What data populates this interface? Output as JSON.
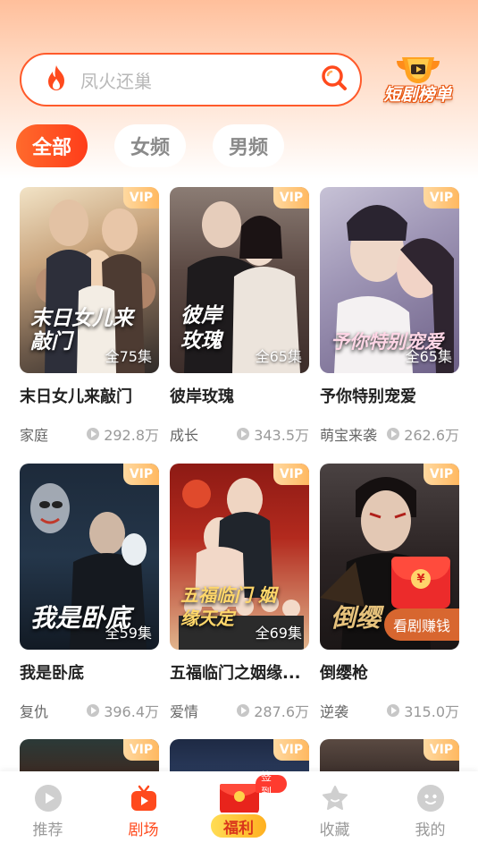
{
  "search": {
    "placeholder": "凤火还巢"
  },
  "ranking": {
    "label": "短剧榜单"
  },
  "tabs": [
    {
      "label": "全部",
      "active": true
    },
    {
      "label": "女频",
      "active": false
    },
    {
      "label": "男频",
      "active": false
    }
  ],
  "dramas": [
    {
      "title": "末日女儿来敲门",
      "poster_title": "末日女儿来敲门",
      "episodes": "全75集",
      "badge": "VIP",
      "tag": "家庭",
      "views": "292.8万"
    },
    {
      "title": "彼岸玫瑰",
      "poster_title": "彼岸玫瑰",
      "episodes": "全65集",
      "badge": "VIP",
      "tag": "成长",
      "views": "343.5万"
    },
    {
      "title": "予你特别宠爱",
      "poster_title": "予你特别宠爱",
      "episodes": "全65集",
      "badge": "VIP",
      "tag": "萌宝来袭",
      "views": "262.6万"
    },
    {
      "title": "我是卧底",
      "poster_title": "我是卧底",
      "episodes": "全59集",
      "badge": "VIP",
      "tag": "复仇",
      "views": "396.4万"
    },
    {
      "title": "五福临门之姻缘...",
      "poster_title": "五福临门 姻缘天定",
      "episodes": "全69集",
      "badge": "VIP",
      "tag": "爱情",
      "views": "287.6万"
    },
    {
      "title": "倒缨枪",
      "poster_title": "倒缨",
      "episodes": "",
      "badge": "VIP",
      "tag": "逆袭",
      "views": "315.0万",
      "promo": "看剧赚钱"
    }
  ],
  "partial_row": [
    {
      "badge": "VIP"
    },
    {
      "badge": "VIP"
    },
    {
      "badge": "VIP"
    }
  ],
  "nav": {
    "items": [
      {
        "label": "推荐",
        "icon": "play-circle-icon",
        "active": false
      },
      {
        "label": "剧场",
        "icon": "tv-icon",
        "active": true
      },
      {
        "label": "福利",
        "icon": "red-packet-icon",
        "active": false,
        "badge": "签到"
      },
      {
        "label": "收藏",
        "icon": "star-icon",
        "active": false
      },
      {
        "label": "我的",
        "icon": "profile-icon",
        "active": false
      }
    ]
  }
}
